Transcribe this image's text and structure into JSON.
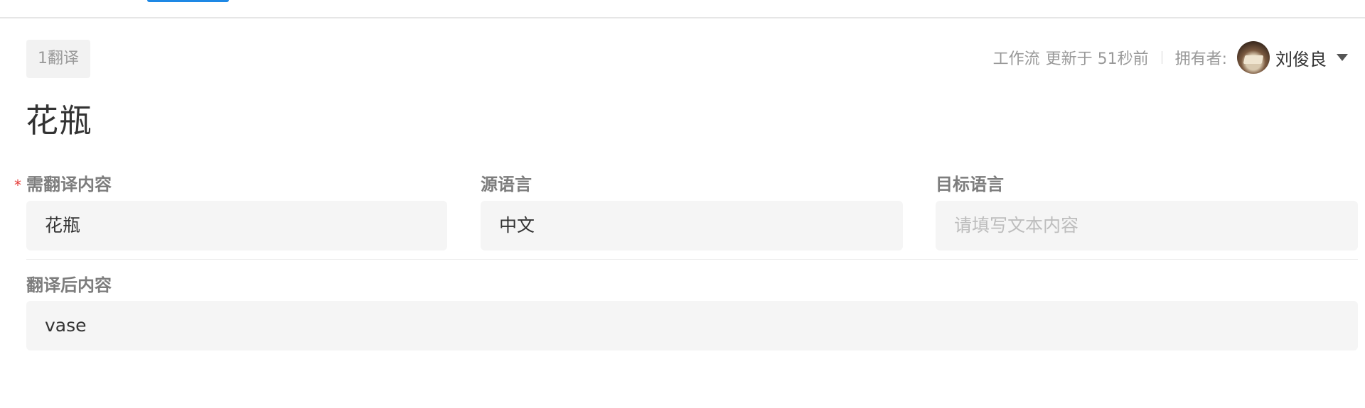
{
  "record": {
    "tag": "1翻译",
    "title": "花瓶"
  },
  "meta": {
    "workflow_label": "工作流",
    "updated_text": "更新于 51秒前",
    "owner_label": "拥有者:",
    "owner_name": "刘俊良"
  },
  "fields": {
    "content_to_translate": {
      "label": "需翻译内容",
      "required_mark": "*",
      "value": "花瓶"
    },
    "source_language": {
      "label": "源语言",
      "value": "中文"
    },
    "target_language": {
      "label": "目标语言",
      "value": "",
      "placeholder": "请填写文本内容"
    },
    "translated_content": {
      "label": "翻译后内容",
      "value": "vase"
    }
  },
  "colors": {
    "accent": "#1e88e5",
    "required": "#e53935",
    "field_bg": "#f5f5f5"
  }
}
